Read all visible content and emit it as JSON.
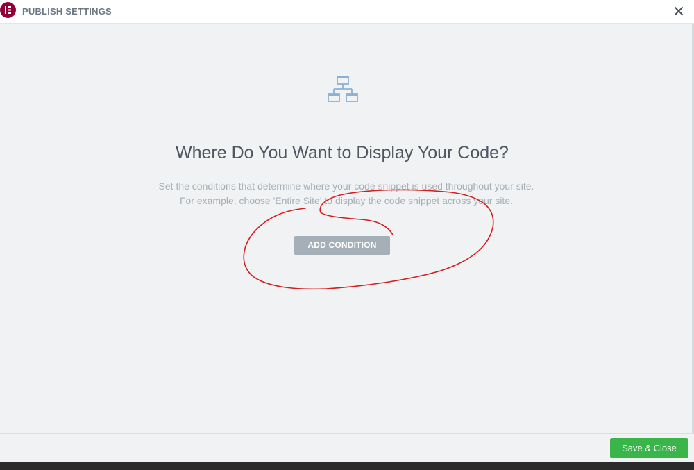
{
  "header": {
    "title": "PUBLISH SETTINGS",
    "logo_icon": "elementor-logo-icon",
    "close_icon": "close-icon"
  },
  "main": {
    "icon": "sitemap-icon",
    "headline": "Where Do You Want to Display Your Code?",
    "description_line1": "Set the conditions that determine where your code snippet is used throughout your site.",
    "description_line2": "For example, choose 'Entire Site' to display the code snippet across your site.",
    "add_condition_label": "ADD CONDITION"
  },
  "footer": {
    "save_close_label": "Save & Close"
  },
  "colors": {
    "brand": "#92003b",
    "save_button": "#39b54a",
    "annotation": "#d41d1d",
    "add_button": "#a4afb7"
  }
}
